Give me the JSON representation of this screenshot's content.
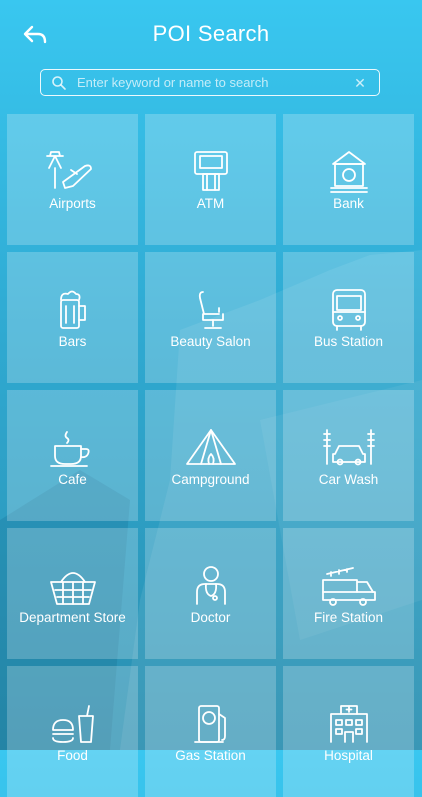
{
  "header": {
    "title": "POI Search",
    "back_icon": "back-arrow-icon"
  },
  "search": {
    "placeholder": "Enter keyword or name to search",
    "value": "",
    "search_icon": "search-icon",
    "clear_icon": "clear-icon"
  },
  "colors": {
    "background_top": "#39c7f0",
    "background_bottom": "#2a8fb0",
    "tile": "rgba(255,255,255,0.22)",
    "text": "#ffffff"
  },
  "categories": [
    {
      "label": "Airports",
      "icon": "airport-icon"
    },
    {
      "label": "ATM",
      "icon": "atm-icon"
    },
    {
      "label": "Bank",
      "icon": "bank-icon"
    },
    {
      "label": "Bars",
      "icon": "beer-icon"
    },
    {
      "label": "Beauty Salon",
      "icon": "salon-chair-icon"
    },
    {
      "label": "Bus Station",
      "icon": "bus-icon"
    },
    {
      "label": "Cafe",
      "icon": "coffee-cup-icon"
    },
    {
      "label": "Campground",
      "icon": "tent-icon"
    },
    {
      "label": "Car Wash",
      "icon": "car-wash-icon"
    },
    {
      "label": "Department Store",
      "icon": "basket-icon"
    },
    {
      "label": "Doctor",
      "icon": "doctor-icon"
    },
    {
      "label": "Fire Station",
      "icon": "fire-truck-icon"
    },
    {
      "label": "Food",
      "icon": "food-icon"
    },
    {
      "label": "Gas Station",
      "icon": "gas-pump-icon"
    },
    {
      "label": "Hospital",
      "icon": "hospital-icon"
    }
  ]
}
